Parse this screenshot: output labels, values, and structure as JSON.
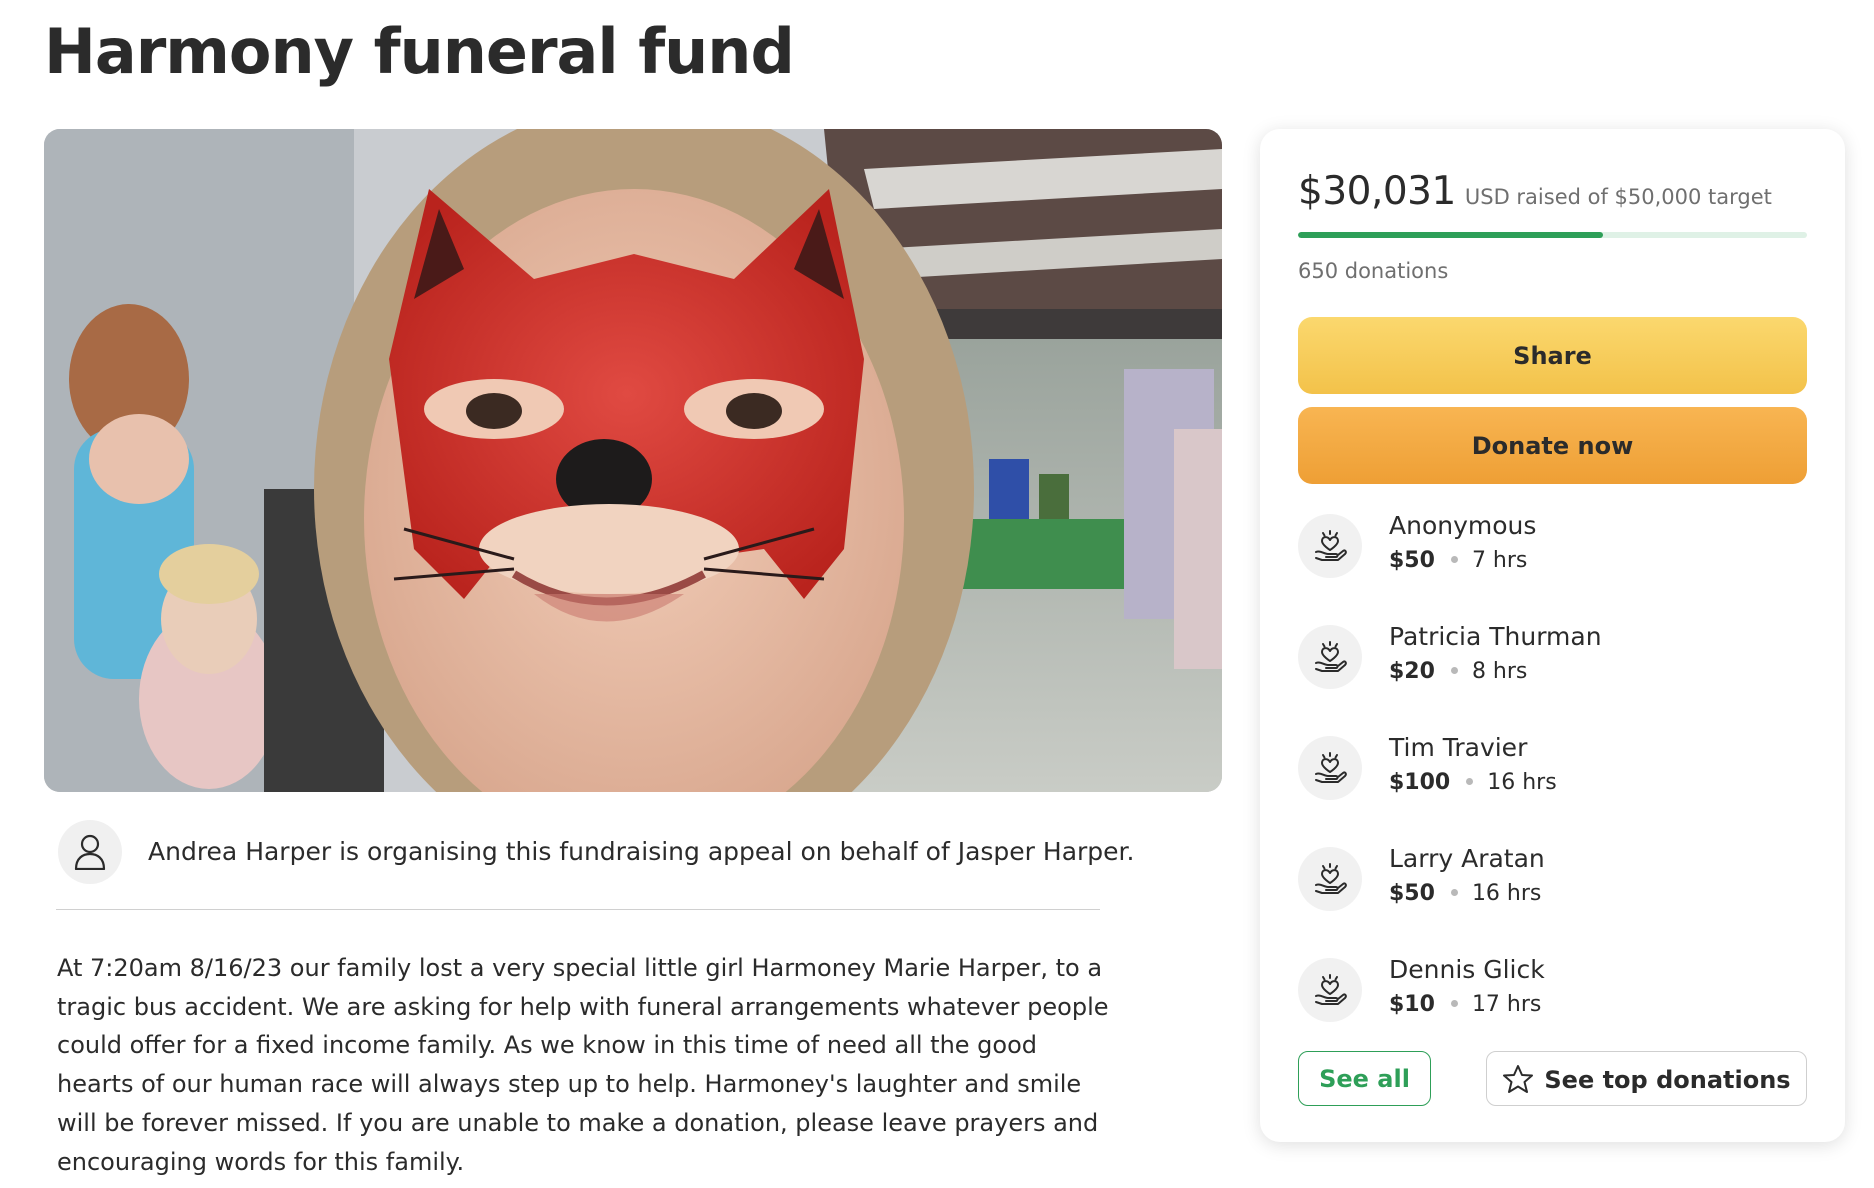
{
  "page": {
    "title": "Harmony funeral fund"
  },
  "hero": {
    "image_icon": "photo-image"
  },
  "organiser": {
    "icon": "person-icon",
    "text": "Andrea Harper is organising this fundraising appeal on behalf of Jasper Harper."
  },
  "story": {
    "text": "At 7:20am 8/16/23 our family lost a very special little girl Harmoney Marie Harper, to a tragic bus accident.  We are asking for help with funeral arrangements whatever people could offer for a fixed income family.  As we know in this time of need all the good hearts of our human race will always step up to help.  Harmoney's laughter and smile will be forever missed. If you are unable to make a donation, please leave prayers and encouraging words for this family."
  },
  "fundraiser": {
    "raised_amount": "$30,031",
    "raised_label": "USD raised of $50,000 target",
    "progress_fraction": 0.6,
    "donations_count": "650 donations",
    "share_label": "Share",
    "donate_label": "Donate now",
    "see_all_label": "See all",
    "top_donations_label": "See top donations",
    "colors": {
      "progress_fill": "#2e9f58",
      "progress_track": "#dff1e6",
      "share_button": "#f3c24a",
      "donate_button": "#ee9f35"
    }
  },
  "donors": [
    {
      "name": "Anonymous",
      "amount": "$50",
      "time": "7 hrs",
      "icon": "heart-hand-icon"
    },
    {
      "name": "Patricia Thurman",
      "amount": "$20",
      "time": "8 hrs",
      "icon": "heart-hand-icon"
    },
    {
      "name": "Tim Travier",
      "amount": "$100",
      "time": "16 hrs",
      "icon": "heart-hand-icon"
    },
    {
      "name": "Larry Aratan",
      "amount": "$50",
      "time": "16 hrs",
      "icon": "heart-hand-icon"
    },
    {
      "name": "Dennis Glick",
      "amount": "$10",
      "time": "17 hrs",
      "icon": "heart-hand-icon"
    }
  ]
}
